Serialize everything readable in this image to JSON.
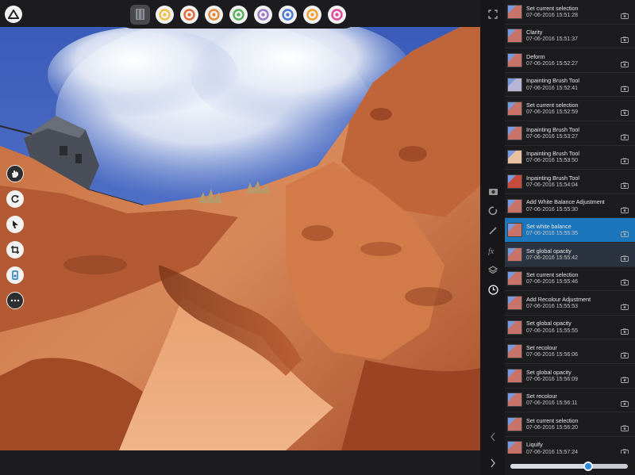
{
  "personas": [
    {
      "icon": "photo-persona-icon",
      "color": "#8a8f99"
    },
    {
      "icon": "liquify-persona-icon",
      "color": "#f0c040"
    },
    {
      "icon": "develop-persona-icon",
      "color": "#e06a3a"
    },
    {
      "icon": "tone-mapping-persona-icon",
      "color": "#e58a3a"
    },
    {
      "icon": "export-persona-icon",
      "color": "#5ab05a"
    },
    {
      "icon": "color-wheel-icon",
      "color": "#9a7ac8"
    },
    {
      "icon": "color-picker-icon",
      "color": "#4a7ad8"
    },
    {
      "icon": "target-icon",
      "color": "#f0a030"
    },
    {
      "icon": "flower-icon",
      "color": "#e04a9a"
    }
  ],
  "history": {
    "selected_index": 9,
    "items": [
      {
        "name": "Set current selection",
        "time": "07-06-2016 15:51:28",
        "thumb": "#c8736a"
      },
      {
        "name": "Clarity",
        "time": "07-06-2016 15:51:37",
        "thumb": "#c8736a"
      },
      {
        "name": "Deform",
        "time": "07-06-2016 15:52:27",
        "thumb": "#c8736a"
      },
      {
        "name": "Inpainting Brush Tool",
        "time": "07-06-2016 15:52:41",
        "thumb": "#b8b4d6"
      },
      {
        "name": "Set current selection",
        "time": "07-06-2016 15:52:59",
        "thumb": "#c8736a"
      },
      {
        "name": "Inpainting Brush Tool",
        "time": "07-06-2016 15:53:27",
        "thumb": "#c8736a"
      },
      {
        "name": "Inpainting Brush Tool",
        "time": "07-06-2016 15:53:50",
        "thumb": "#e8c2a0"
      },
      {
        "name": "Inpainting Brush Tool",
        "time": "07-06-2016 15:54:04",
        "thumb": "#c84a3a"
      },
      {
        "name": "Add White Balance Adjustment",
        "time": "07-06-2016 15:55:30",
        "thumb": "#c8736a"
      },
      {
        "name": "Set white balance",
        "time": "07-06-2016 15:55:35",
        "thumb": "#c8736a"
      },
      {
        "name": "Set global opacity",
        "time": "07-06-2016 15:55:42",
        "thumb": "#c8736a"
      },
      {
        "name": "Set current selection",
        "time": "07-06-2016 15:55:46",
        "thumb": "#c8736a"
      },
      {
        "name": "Add Recolour Adjustment",
        "time": "07-06-2016 15:55:53",
        "thumb": "#c8736a"
      },
      {
        "name": "Set global opacity",
        "time": "07-06-2016 15:55:55",
        "thumb": "#c8736a"
      },
      {
        "name": "Set recolour",
        "time": "07-06-2016 15:56:06",
        "thumb": "#c8736a"
      },
      {
        "name": "Set global opacity",
        "time": "07-06-2016 15:56:09",
        "thumb": "#c8736a"
      },
      {
        "name": "Set recolour",
        "time": "07-06-2016 15:56:11",
        "thumb": "#c8736a"
      },
      {
        "name": "Set current selection",
        "time": "07-06-2016 15:56:20",
        "thumb": "#c8736a"
      },
      {
        "name": "Liquify",
        "time": "07-06-2016 15:57:24",
        "thumb": "#c8736a"
      }
    ],
    "slider_value": 0.66
  },
  "colors": {
    "selection": "#1b76bc",
    "accent": "#2d8ad8",
    "panel": "#1c1c1e"
  }
}
